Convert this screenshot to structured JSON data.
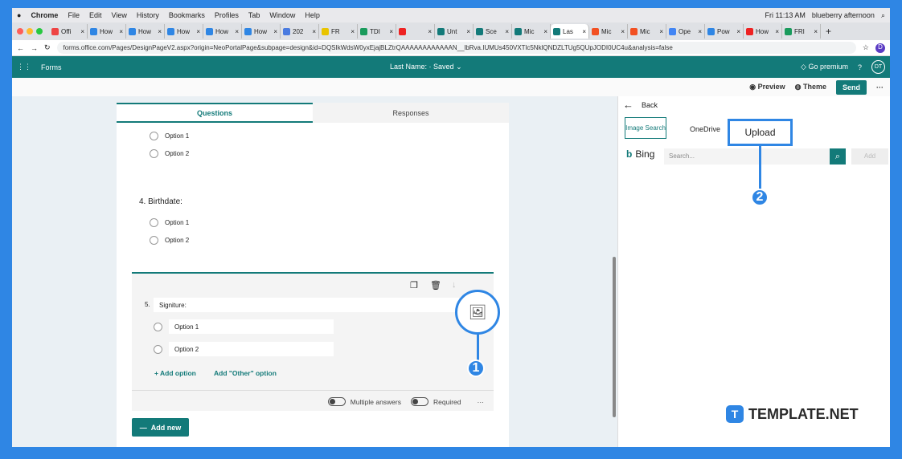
{
  "menubar": {
    "app": "Chrome",
    "items": [
      "File",
      "Edit",
      "View",
      "History",
      "Bookmarks",
      "Profiles",
      "Tab",
      "Window",
      "Help"
    ],
    "clock": "Fri 11:13 AM",
    "user": "blueberry afternoon"
  },
  "tabs": [
    {
      "t": "Offi",
      "c": "#e44"
    },
    {
      "t": "How",
      "c": "#2f86e4"
    },
    {
      "t": "How",
      "c": "#2f86e4"
    },
    {
      "t": "How",
      "c": "#2f86e4"
    },
    {
      "t": "How",
      "c": "#2f86e4"
    },
    {
      "t": "How",
      "c": "#2f86e4"
    },
    {
      "t": "202",
      "c": "#4a7be0"
    },
    {
      "t": "FR",
      "c": "#e9c400"
    },
    {
      "t": "TDI",
      "c": "#1a9b5c"
    },
    {
      "t": "",
      "c": "#e22"
    },
    {
      "t": "Unt",
      "c": "#137a79"
    },
    {
      "t": "Sce",
      "c": "#137a79"
    },
    {
      "t": "Mic",
      "c": "#137a79"
    },
    {
      "t": "Las",
      "c": "#137a79",
      "active": true
    },
    {
      "t": "Mic",
      "c": "#f25022"
    },
    {
      "t": "Mic",
      "c": "#f25022"
    },
    {
      "t": "Ope",
      "c": "#4285f4"
    },
    {
      "t": "Pow",
      "c": "#2f86e4"
    },
    {
      "t": "How",
      "c": "#e22"
    },
    {
      "t": "FRI",
      "c": "#1a9b5c"
    }
  ],
  "address": {
    "url": "forms.office.com/Pages/DesignPageV2.aspx?origin=NeoPortalPage&subpage=design&id=DQSIkWdsW0yxEjajBLZtrQAAAAAAAAAAAAN__lbRva.IUMUs450VXTlc5NklQNDZLTUg5QUpJODI0UC4u&analysis=false",
    "profile": "D"
  },
  "forms": {
    "app": "Forms",
    "title": "Last Name:",
    "status": "Saved",
    "premium": "Go premium",
    "help": "?",
    "avatar": "DT"
  },
  "toolbar": {
    "preview": "Preview",
    "theme": "Theme",
    "send": "Send",
    "more": "···"
  },
  "card": {
    "tab_questions": "Questions",
    "tab_responses": "Responses",
    "q3_options": [
      "Option 1",
      "Option 2"
    ],
    "q4_title": "4. Birthdate:",
    "q4_options": [
      "Option 1",
      "Option 2"
    ],
    "q5_number": "5.",
    "q5_title": "Signiture:",
    "q5_options": [
      "Option 1",
      "Option 2"
    ],
    "add_option": "Add option",
    "add_other": "Add \"Other\" option",
    "multiple": "Multiple answers",
    "required": "Required",
    "more": "···",
    "add_new": "Add new"
  },
  "panel": {
    "back": "Back",
    "tabs": [
      "Image Search",
      "OneDrive",
      "Upload"
    ],
    "bing": "Bing",
    "search_placeholder": "Search...",
    "add": "Add"
  },
  "callouts": {
    "one": "1",
    "two": "2"
  },
  "watermark": "TEMPLATE.NET",
  "colors": {
    "brand": "#137a79",
    "callout": "#2f86e4"
  }
}
